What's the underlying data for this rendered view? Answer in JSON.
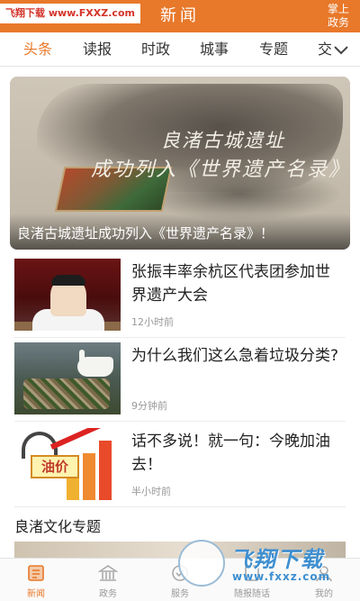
{
  "header": {
    "watermark": "飞翔下载 www.FXXZ.com",
    "title": "新闻",
    "right_link": "掌上政务",
    "bg_color": "#e8782a"
  },
  "tabs": {
    "items": [
      {
        "label": "头条",
        "active": true
      },
      {
        "label": "读报",
        "active": false
      },
      {
        "label": "时政",
        "active": false
      },
      {
        "label": "城事",
        "active": false
      },
      {
        "label": "专题",
        "active": false
      },
      {
        "label": "交",
        "active": false
      }
    ],
    "more_icon": "chevron-down-icon",
    "active_color": "#e8782a"
  },
  "hero": {
    "image_text_line1": "良渚古城遗址",
    "image_text_line2": "成功列入《世界遗产名录》",
    "caption": "良渚古城遗址成功列入《世界遗产名录》！"
  },
  "news": [
    {
      "headline": "张振丰率余杭区代表团参加世界遗产大会",
      "time": "12小时前"
    },
    {
      "headline": "为什么我们这么急着垃圾分类?",
      "time": "9分钟前"
    },
    {
      "headline": "话不多说！就一句：今晚加油去！",
      "time": "半小时前",
      "thumb_text": "油价"
    }
  ],
  "section": {
    "title": "良渚文化专题"
  },
  "bottom_nav": [
    {
      "label": "新闻",
      "icon": "news-icon",
      "active": true
    },
    {
      "label": "政务",
      "icon": "government-icon",
      "active": false
    },
    {
      "label": "服务",
      "icon": "service-icon",
      "active": false
    },
    {
      "label": "随报随话",
      "icon": "report-icon",
      "active": false
    },
    {
      "label": "我的",
      "icon": "profile-icon",
      "active": false
    }
  ],
  "overlay_watermark": {
    "brand": "飞翔下载",
    "url": "www.fxxz.com"
  }
}
